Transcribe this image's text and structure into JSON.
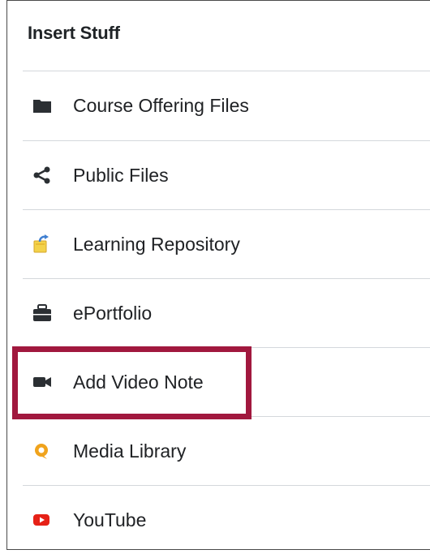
{
  "panel": {
    "title": "Insert Stuff"
  },
  "items": [
    {
      "label": "Course Offering Files",
      "icon": "folder-icon"
    },
    {
      "label": "Public Files",
      "icon": "share-icon"
    },
    {
      "label": "Learning Repository",
      "icon": "repository-icon"
    },
    {
      "label": "ePortfolio",
      "icon": "briefcase-icon"
    },
    {
      "label": "Add Video Note",
      "icon": "video-camera-icon"
    },
    {
      "label": "Media Library",
      "icon": "media-library-icon"
    },
    {
      "label": "YouTube",
      "icon": "youtube-icon"
    }
  ],
  "colors": {
    "highlight": "#a1183e",
    "media_library_accent": "#f0a31c",
    "youtube_red": "#e62117",
    "repository_yellow": "#f3d24a",
    "repository_blue": "#3f7fd1"
  }
}
